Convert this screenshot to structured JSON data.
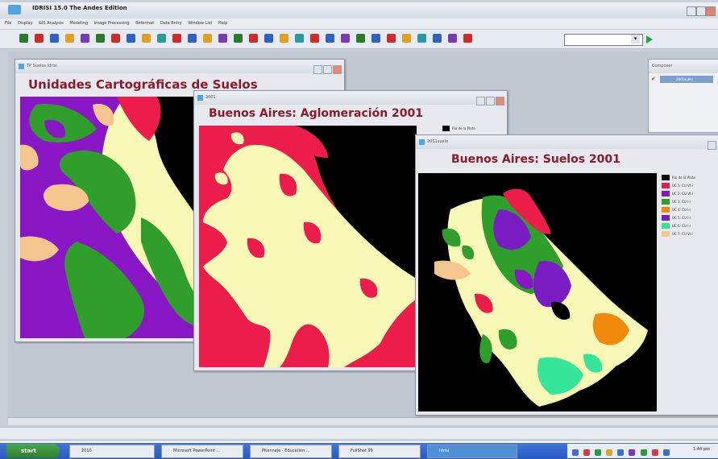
{
  "app": {
    "title": "IDRISI 15.0    The Andes Edition"
  },
  "menu": [
    "File",
    "Display",
    "GIS Analysis",
    "Modeling",
    "Image Processing",
    "Reformat",
    "Data Entry",
    "Window List",
    "Help"
  ],
  "composer": {
    "title": "Composer",
    "layer": "2001suelo"
  },
  "windows": [
    {
      "title": "TP Suelos Idrisi",
      "map_title": "Unidades Cartográficas de Suelos"
    },
    {
      "title": "2001",
      "map_title": "Buenos Aires: Aglomeración 2001",
      "legend_label": "Rio de la Plata"
    },
    {
      "title": "2001suelo",
      "map_title": "Buenos Aires: Suelos 2001"
    }
  ],
  "legend": [
    {
      "label": "Rio de la Plata",
      "color": "#000000"
    },
    {
      "label": "UC 1: CU Vt-l",
      "color": "#e0204a"
    },
    {
      "label": "UC 2: CU Vt-l",
      "color": "#8a17c6"
    },
    {
      "label": "UC 3: CU l-l",
      "color": "#2f9e2a"
    },
    {
      "label": "UC 4: CU l-l",
      "color": "#f18a0c"
    },
    {
      "label": "UC 5: CU l-l",
      "color": "#7a1cc4"
    },
    {
      "label": "UC 6: CU l-l",
      "color": "#2ee68e"
    },
    {
      "label": "UC 7: CU Vl-l",
      "color": "#f5c58e"
    }
  ],
  "colors": {
    "black": "#000000",
    "red": "#ec1d4a",
    "cream": "#f7f8b5",
    "purple": "#8a17c6",
    "green": "#2f9e2a",
    "teal": "#35e69a",
    "peach": "#f5c58e",
    "orange": "#f18a0c"
  },
  "taskbar": {
    "start": "start",
    "items": [
      "2010",
      "Microsoft PowerPoint ...",
      "Pitonneje - Education ...",
      "FullShot 99",
      "Idrisi"
    ],
    "clock": "1:44 pm"
  }
}
